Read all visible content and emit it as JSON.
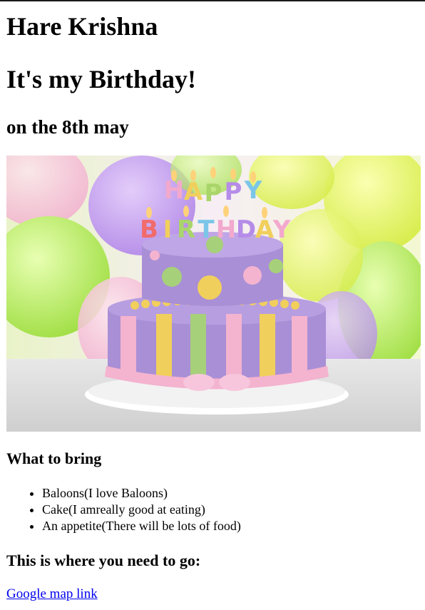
{
  "page": {
    "heading_1": "Hare Krishna",
    "heading_2": "It's my Birthday!",
    "heading_3": "on the 8th may"
  },
  "image": {
    "name": "birthday-cake",
    "candle_letters": "HAPPY BIRTHDAY"
  },
  "what_to_bring": {
    "heading": "What to bring",
    "items": [
      "Baloons(I love Baloons)",
      "Cake(I amreally good at eating)",
      "An appetite(There will be lots of food)"
    ]
  },
  "directions": {
    "heading": "This is where you need to go:",
    "link_text": "Google map link"
  },
  "colors": {
    "link": "#0000ee",
    "top_rule": "#1a1a1a",
    "cake_purple": "#a98fd6",
    "cake_pink": "#f4b3cf"
  }
}
